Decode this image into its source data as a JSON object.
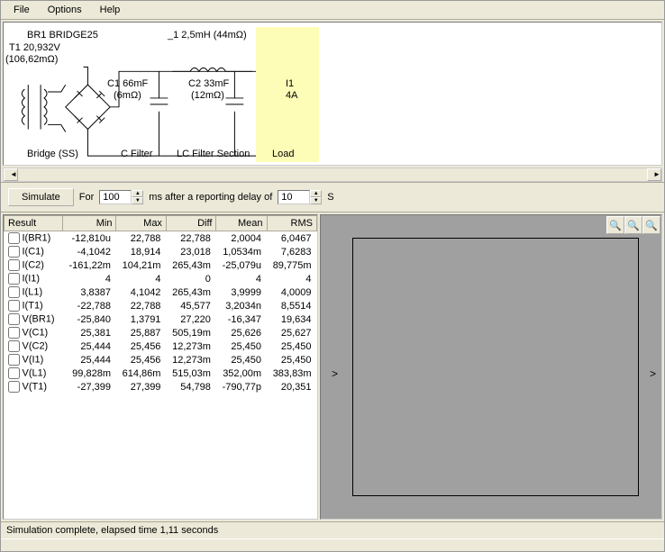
{
  "menu": {
    "file": "File",
    "options": "Options",
    "help": "Help"
  },
  "circuit": {
    "br1": "BR1 BRIDGE25",
    "t1": "T1 20,932V",
    "t1b": "(106,62mΩ)",
    "l1": "_1 2,5mH (44mΩ)",
    "c1": "C1 66mF",
    "c1b": "(6mΩ)",
    "c2": "C2 33mF",
    "c2b": "(12mΩ)",
    "i1": "I1",
    "i1b": "4A",
    "lab_bridge": "Bridge (SS)",
    "lab_cfilter": "C Filter",
    "lab_lc": "LC Filter Section",
    "lab_load": "Load"
  },
  "controls": {
    "simulate": "Simulate",
    "for": "For",
    "ms_txt": "ms  after a reporting delay of",
    "s": "S",
    "duration": "100",
    "delay": "10"
  },
  "headers": [
    "Result",
    "Min",
    "Max",
    "Diff",
    "Mean",
    "RMS"
  ],
  "rows": [
    {
      "r": "I(BR1)",
      "min": "-12,810u",
      "max": "22,788",
      "diff": "22,788",
      "mean": "2,0004",
      "rms": "6,0467"
    },
    {
      "r": "I(C1)",
      "min": "-4,1042",
      "max": "18,914",
      "diff": "23,018",
      "mean": "1,0534m",
      "rms": "7,6283"
    },
    {
      "r": "I(C2)",
      "min": "-161,22m",
      "max": "104,21m",
      "diff": "265,43m",
      "mean": "-25,079u",
      "rms": "89,775m"
    },
    {
      "r": "I(I1)",
      "min": "4",
      "max": "4",
      "diff": "0",
      "mean": "4",
      "rms": "4"
    },
    {
      "r": "I(L1)",
      "min": "3,8387",
      "max": "4,1042",
      "diff": "265,43m",
      "mean": "3,9999",
      "rms": "4,0009"
    },
    {
      "r": "I(T1)",
      "min": "-22,788",
      "max": "22,788",
      "diff": "45,577",
      "mean": "3,2034n",
      "rms": "8,5514"
    },
    {
      "r": "V(BR1)",
      "min": "-25,840",
      "max": "1,3791",
      "diff": "27,220",
      "mean": "-16,347",
      "rms": "19,634"
    },
    {
      "r": "V(C1)",
      "min": "25,381",
      "max": "25,887",
      "diff": "505,19m",
      "mean": "25,626",
      "rms": "25,627"
    },
    {
      "r": "V(C2)",
      "min": "25,444",
      "max": "25,456",
      "diff": "12,273m",
      "mean": "25,450",
      "rms": "25,450"
    },
    {
      "r": "V(I1)",
      "min": "25,444",
      "max": "25,456",
      "diff": "12,273m",
      "mean": "25,450",
      "rms": "25,450"
    },
    {
      "r": "V(L1)",
      "min": "99,828m",
      "max": "614,86m",
      "diff": "515,03m",
      "mean": "352,00m",
      "rms": "383,83m"
    },
    {
      "r": "V(T1)",
      "min": "-27,399",
      "max": "27,399",
      "diff": "54,798",
      "mean": "-790,77p",
      "rms": "20,351"
    }
  ],
  "status": "Simulation complete, elapsed time 1,11 seconds",
  "zoom": {
    "in": "🔍",
    "out": "🔍",
    "red": "🔍"
  }
}
